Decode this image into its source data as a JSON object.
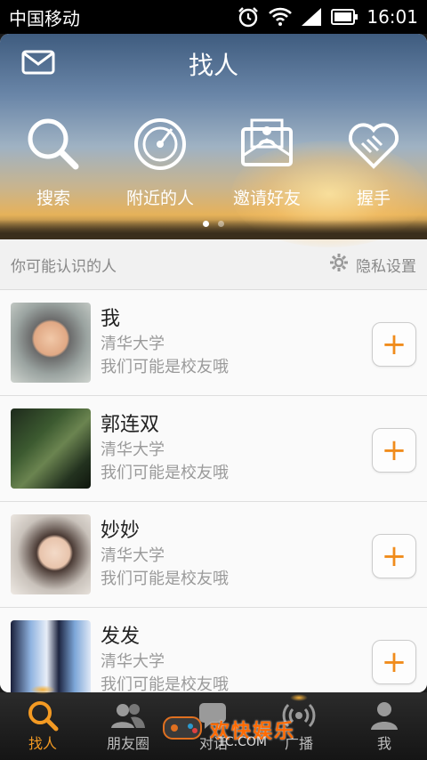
{
  "status_bar": {
    "carrier": "中国移动",
    "time": "16:01"
  },
  "header": {
    "title": "找人"
  },
  "actions": [
    {
      "label": "搜索",
      "icon": "search-icon"
    },
    {
      "label": "附近的人",
      "icon": "radar-icon"
    },
    {
      "label": "邀请好友",
      "icon": "invite-envelope-icon"
    },
    {
      "label": "握手",
      "icon": "handshake-heart-icon"
    }
  ],
  "pager": {
    "pages": 2,
    "active": 1
  },
  "section": {
    "title": "你可能认识的人",
    "privacy_label": "隐私设置"
  },
  "people": [
    {
      "name": "我",
      "school": "清华大学",
      "note": "我们可能是校友哦"
    },
    {
      "name": "郭连双",
      "school": "清华大学",
      "note": "我们可能是校友哦"
    },
    {
      "name": "妙妙",
      "school": "清华大学",
      "note": "我们可能是校友哦"
    },
    {
      "name": "发发",
      "school": "清华大学",
      "note": "我们可能是校友哦"
    }
  ],
  "add_label": "+",
  "tabs": [
    {
      "label": "找人",
      "active": true
    },
    {
      "label": "朋友圈",
      "active": false
    },
    {
      "label": "对话",
      "active": false
    },
    {
      "label": "广播",
      "active": false
    },
    {
      "label": "我",
      "active": false
    }
  ],
  "watermark": {
    "text": "欢快娱乐",
    "url": "1C.COM"
  },
  "colors": {
    "accent": "#f08c1c",
    "tab_active": "#f39a23",
    "text_muted": "#9a9a9a"
  }
}
